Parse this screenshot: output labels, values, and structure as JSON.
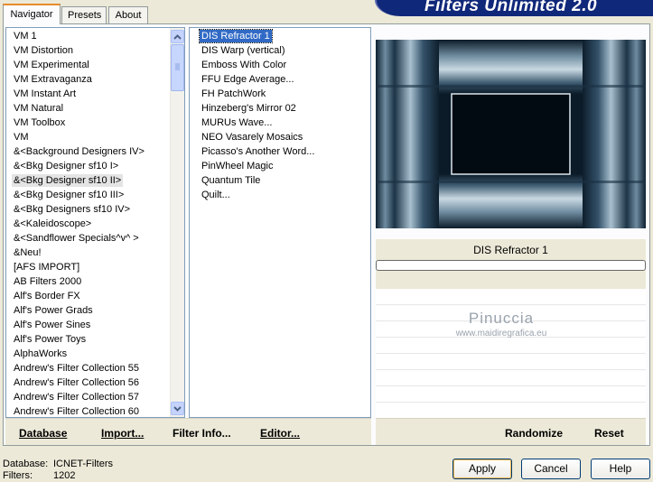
{
  "tabs": [
    {
      "label": "Navigator"
    },
    {
      "label": "Presets"
    },
    {
      "label": "About"
    }
  ],
  "banner_title": "Filters Unlimited 2.0",
  "categories": {
    "items": [
      "VM 1",
      "VM Distortion",
      "VM Experimental",
      "VM Extravaganza",
      "VM Instant Art",
      "VM Natural",
      "VM Toolbox",
      "VM",
      "&<Background Designers IV>",
      "&<Bkg Designer sf10 I>",
      "&<Bkg Designer sf10 II>",
      "&<Bkg Designer sf10 III>",
      "&<Bkg Designers sf10 IV>",
      "&<Kaleidoscope>",
      "&<Sandflower Specials^v^ >",
      "&Neu!",
      "[AFS IMPORT]",
      "AB Filters 2000",
      "Alf's Border FX",
      "Alf's Power Grads",
      "Alf's Power Sines",
      "Alf's Power Toys",
      "AlphaWorks",
      "Andrew's Filter Collection 55",
      "Andrew's Filter Collection 56",
      "Andrew's Filter Collection 57",
      "Andrew's Filter Collection 60"
    ],
    "selected": "&<Bkg Designer sf10 II>"
  },
  "filters": {
    "items": [
      "DIS Refractor 1",
      "DIS Warp (vertical)",
      "Emboss With Color",
      "FFU Edge Average...",
      "FH PatchWork",
      "Hinzeberg's Mirror 02",
      "MURUs Wave...",
      "NEO Vasarely Mosaics",
      "Picasso's Another Word...",
      "PinWheel Magic",
      "Quantum Tile",
      "Quilt..."
    ],
    "selected": "DIS Refractor 1"
  },
  "toolbar": {
    "database": "Database",
    "import": "Import...",
    "filter_info": "Filter Info...",
    "editor": "Editor...",
    "randomize": "Randomize",
    "reset": "Reset"
  },
  "preview": {
    "filter_name": "DIS Refractor 1",
    "watermark_name": "Pinuccia",
    "watermark_url": "www.maidiregrafica.eu"
  },
  "status": {
    "database_label": "Database:",
    "database_value": "ICNET-Filters",
    "filters_label": "Filters:",
    "filters_value": "1202"
  },
  "buttons": {
    "apply": "Apply",
    "cancel": "Cancel",
    "help": "Help"
  },
  "colors": {
    "selection": "#316ac5",
    "banner": "#10287a",
    "tab_accent": "#e68b2c"
  }
}
